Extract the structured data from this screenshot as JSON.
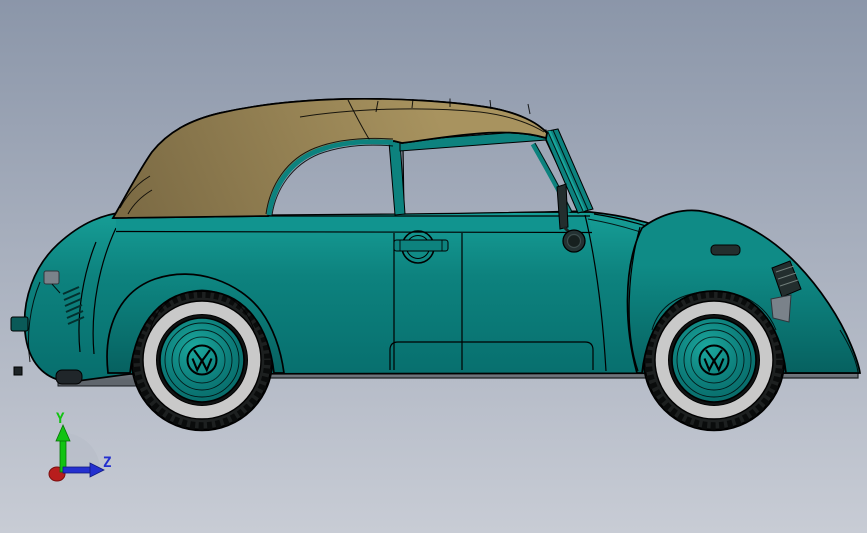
{
  "triad": {
    "y_label": "Y",
    "z_label": "Z"
  },
  "model": {
    "hubcap_badge": "VW"
  },
  "colors": {
    "bg_top": "#8b96a9",
    "bg_bottom": "#c8ccd5",
    "body_light": "#1aa89f",
    "body_mid": "#0d827e",
    "body_dark": "#076e6d",
    "beltline": "#11948f",
    "fender_top": "#0f8b86",
    "fender_bottom": "#065f5e",
    "top_light": "#a8935f",
    "top_dark": "#7d6c45",
    "outline": "#000000",
    "tire": "#1d2020",
    "tread": "#0a0c0c",
    "whitewall": "#c9c9c9",
    "hub_light": "#1ba79d",
    "hub_mid": "#0c7b78",
    "hub_dark": "#076665",
    "running_top": "#878d94",
    "running_bottom": "#60666d",
    "metal_dark": "#232e2e",
    "part_gray": "#7a828a",
    "axis_x": "#b81d1d",
    "axis_y": "#12c312",
    "axis_z": "#2430cf",
    "arc_gray": "#b7bdc7"
  }
}
